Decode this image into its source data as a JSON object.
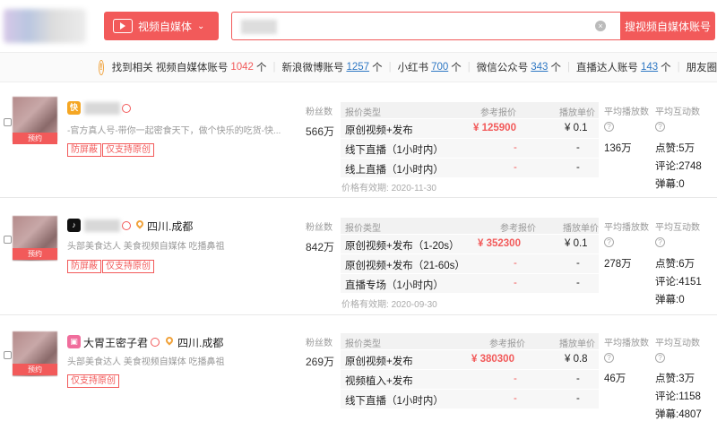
{
  "header": {
    "platform_button": "视频自媒体",
    "search_button": "搜视频自媒体账号"
  },
  "summary": {
    "prefix": "找到相关",
    "items": [
      {
        "label": "视频自媒体账号",
        "count": "1042",
        "unit": "个"
      },
      {
        "label": "新浪微博账号",
        "count": "1257",
        "unit": "个"
      },
      {
        "label": "小红书",
        "count": "700",
        "unit": "个"
      },
      {
        "label": "微信公众号",
        "count": "343",
        "unit": "个"
      },
      {
        "label": "直播达人账号",
        "count": "143",
        "unit": "个"
      },
      {
        "label": "朋友圈",
        "count": "",
        "unit": ""
      }
    ]
  },
  "labels": {
    "fans": "粉丝数",
    "price_type": "报价类型",
    "ref_price": "参考报价",
    "unit_price": "播放单价",
    "avg_play": "平均播放数",
    "avg_interact": "平均互动数",
    "reserve": "预约",
    "valid_prefix": "价格有效期:",
    "likes": "点赞:",
    "comments": "评论:",
    "danmu": "弹幕:",
    "help": "?"
  },
  "accounts": [
    {
      "platform_icon": "kuaishou-icon",
      "platform_color": "#f5a623",
      "name": "",
      "location": "",
      "desc": "-官方真人号-带你一起密食天下，做个快乐的吃货-快...",
      "tags": [
        "防屏蔽",
        "仅支持原创"
      ],
      "fans": "566万",
      "prices": [
        {
          "type": "原创视频+发布",
          "price": "¥ 125900",
          "unit": "¥ 0.1"
        },
        {
          "type": "线下直播（1小时内）",
          "price": "-",
          "unit": "-"
        },
        {
          "type": "线上直播（1小时内）",
          "price": "-",
          "unit": "-"
        }
      ],
      "valid": "2020-11-30",
      "avg_play": "136万",
      "likes": "5万",
      "comments": "2748",
      "danmu": "0"
    },
    {
      "platform_icon": "douyin-icon",
      "platform_color": "#111111",
      "name": "",
      "location": "四川.成都",
      "desc": "头部美食达人 美食视频自媒体 吃播鼻祖",
      "tags": [
        "防屏蔽",
        "仅支持原创"
      ],
      "fans": "842万",
      "prices": [
        {
          "type": "原创视频+发布（1-20s）",
          "price": "¥ 352300",
          "unit": "¥ 0.1"
        },
        {
          "type": "原创视频+发布（21-60s）",
          "price": "-",
          "unit": "-"
        },
        {
          "type": "直播专场（1小时内）",
          "price": "-",
          "unit": "-"
        }
      ],
      "valid": "2020-09-30",
      "avg_play": "278万",
      "likes": "6万",
      "comments": "4151",
      "danmu": "0"
    },
    {
      "platform_icon": "bilibili-icon",
      "platform_color": "#f06d9c",
      "name": "大胃王密子君",
      "location": "四川.成都",
      "desc": "头部美食达人 美食视频自媒体 吃播鼻祖",
      "tags": [
        "仅支持原创"
      ],
      "fans": "269万",
      "prices": [
        {
          "type": "原创视频+发布",
          "price": "¥ 380300",
          "unit": "¥ 0.8"
        },
        {
          "type": "视频植入+发布",
          "price": "-",
          "unit": "-"
        },
        {
          "type": "线下直播（1小时内）",
          "price": "-",
          "unit": "-"
        }
      ],
      "valid": "",
      "avg_play": "46万",
      "likes": "3万",
      "comments": "1158",
      "danmu": "4807"
    }
  ]
}
